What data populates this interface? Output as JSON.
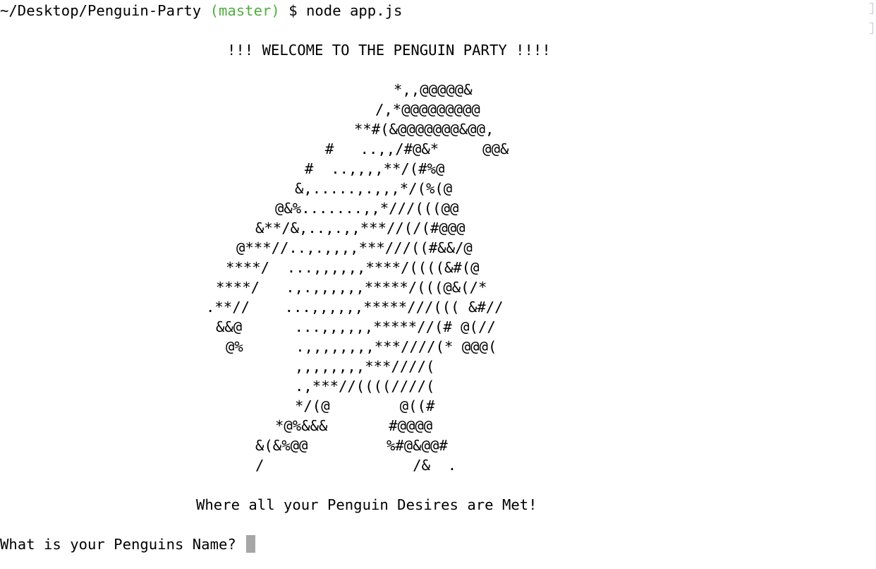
{
  "prompt": {
    "path": "~/Desktop/Penguin-Party",
    "branch": "(master)",
    "symbol": "$",
    "command": "node app.js"
  },
  "colors": {
    "background": "#ffffff",
    "text": "#000000",
    "branch": "#4fae3f",
    "cursor": "#a6a6a6"
  },
  "banner": {
    "welcome": "!!! WELCOME TO THE PENGUIN PARTY !!!!",
    "ascii_art": [
      "*,,@@@@@&",
      "/,*@@@@@@@@@",
      "**#(&@@@@@@@&@@,",
      "#   ..,,/#@&*     @@&",
      "#  ..,,,,**/(#%@",
      "&,.....,.,,,*/(%(@",
      "@&%.......,,*///(((@@",
      "&**/&,..,.,,***//(/(#@@@",
      "@***//..,.,,,,***///((#&&/@",
      "****/  ...,,,,,,****/((((&#(@",
      "****/   .,.,,,,,,*****/(((@&(/*",
      ".**//    ...,,,,,,*****///((( &#//",
      "&&@      ...,,,,,,*****//(# @(//",
      "@%      .,,,,,,,,***////(* @@@(",
      ",,,,,,,,***////(",
      ".,***//((((////(",
      "*/(@        @((#",
      "*@%&&&       #@@@@",
      "&(&%@@         %#@&@@#",
      "/                 /&  ."
    ],
    "tagline": "Where all your Penguin Desires are Met!"
  },
  "question": "What is your Penguins Name? "
}
